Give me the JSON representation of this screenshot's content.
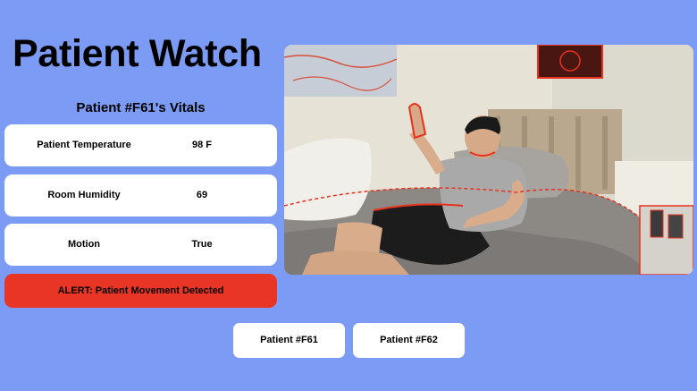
{
  "app": {
    "title": "Patient Watch"
  },
  "vitals": {
    "title": "Patient #F61's Vitals",
    "rows": [
      {
        "label": "Patient Temperature",
        "value": "98 F"
      },
      {
        "label": "Room Humidity",
        "value": "69"
      },
      {
        "label": "Motion",
        "value": "True"
      }
    ]
  },
  "alert": {
    "text": "ALERT: Patient Movement Detected",
    "color": "#e93526"
  },
  "feed": {
    "description_icon": "camera-feed-image"
  },
  "patients": [
    {
      "label": "Patient #F61"
    },
    {
      "label": "Patient #F62"
    }
  ],
  "colors": {
    "background": "#7b9bf4",
    "card": "#ffffff",
    "alert": "#e93526",
    "highlight": "#e8321e"
  }
}
